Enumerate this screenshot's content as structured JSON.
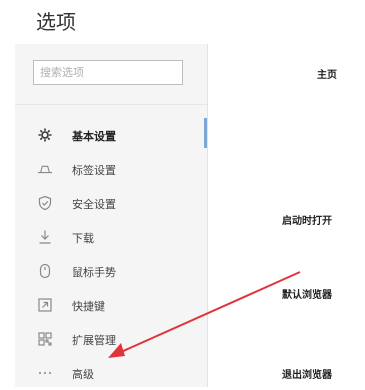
{
  "page": {
    "title": "选项"
  },
  "search": {
    "placeholder": "搜索选项"
  },
  "sidebar": {
    "items": [
      {
        "label": "基本设置",
        "icon": "gear-icon",
        "active": true
      },
      {
        "label": "标签设置",
        "icon": "tab-icon"
      },
      {
        "label": "安全设置",
        "icon": "shield-icon"
      },
      {
        "label": "下载",
        "icon": "download-icon"
      },
      {
        "label": "鼠标手势",
        "icon": "mouse-icon"
      },
      {
        "label": "快捷键",
        "icon": "shortcut-icon"
      },
      {
        "label": "扩展管理",
        "icon": "extensions-icon"
      },
      {
        "label": "高级",
        "icon": "more-icon"
      }
    ]
  },
  "content": {
    "sections": [
      {
        "label": "主页"
      },
      {
        "label": "启动时打开"
      },
      {
        "label": "默认浏览器"
      },
      {
        "label": "退出浏览器"
      }
    ]
  },
  "colors": {
    "accent": "#7ba7d6",
    "annotation_arrow": "#e0343a",
    "sidebar_bg": "#f5f5f5"
  }
}
